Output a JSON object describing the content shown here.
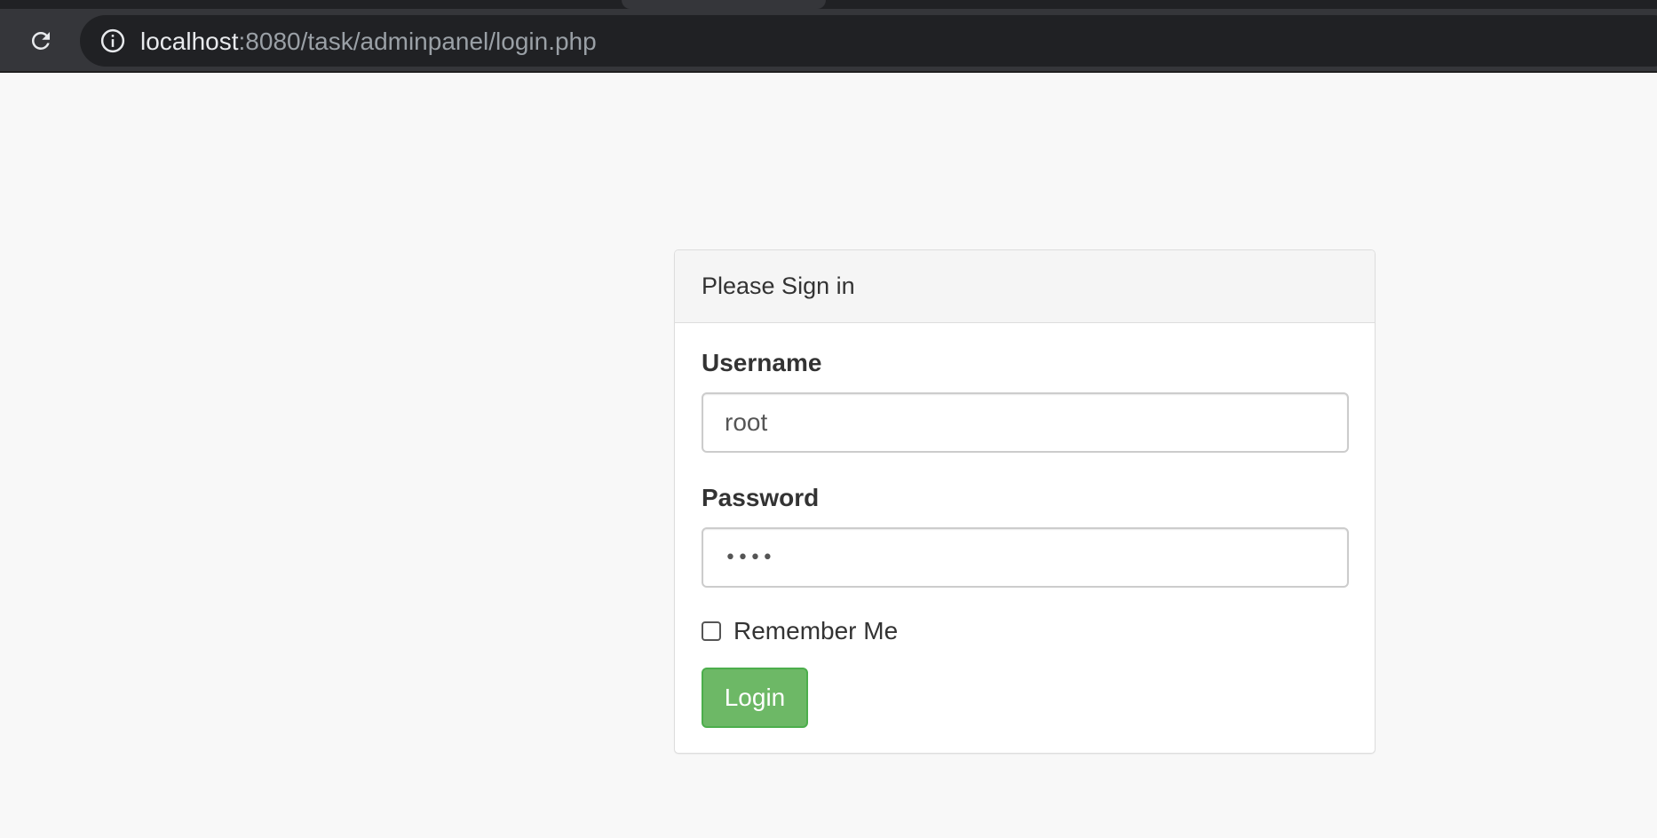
{
  "browser": {
    "reload_icon": "reload-icon",
    "info_icon": "info-icon",
    "url_host": "localhost",
    "url_path": ":8080/task/adminpanel/login.php"
  },
  "login_panel": {
    "title": "Please Sign in",
    "username": {
      "label": "Username",
      "value": "root"
    },
    "password": {
      "label": "Password",
      "value": "••••"
    },
    "remember": {
      "label": "Remember Me",
      "checked": false
    },
    "login_button_label": "Login"
  },
  "colors": {
    "page_background": "#f8f8f8",
    "browser_toolbar": "#35363a",
    "omnibox": "#202124",
    "login_button": "#6db866",
    "panel_heading": "#f5f5f5"
  }
}
